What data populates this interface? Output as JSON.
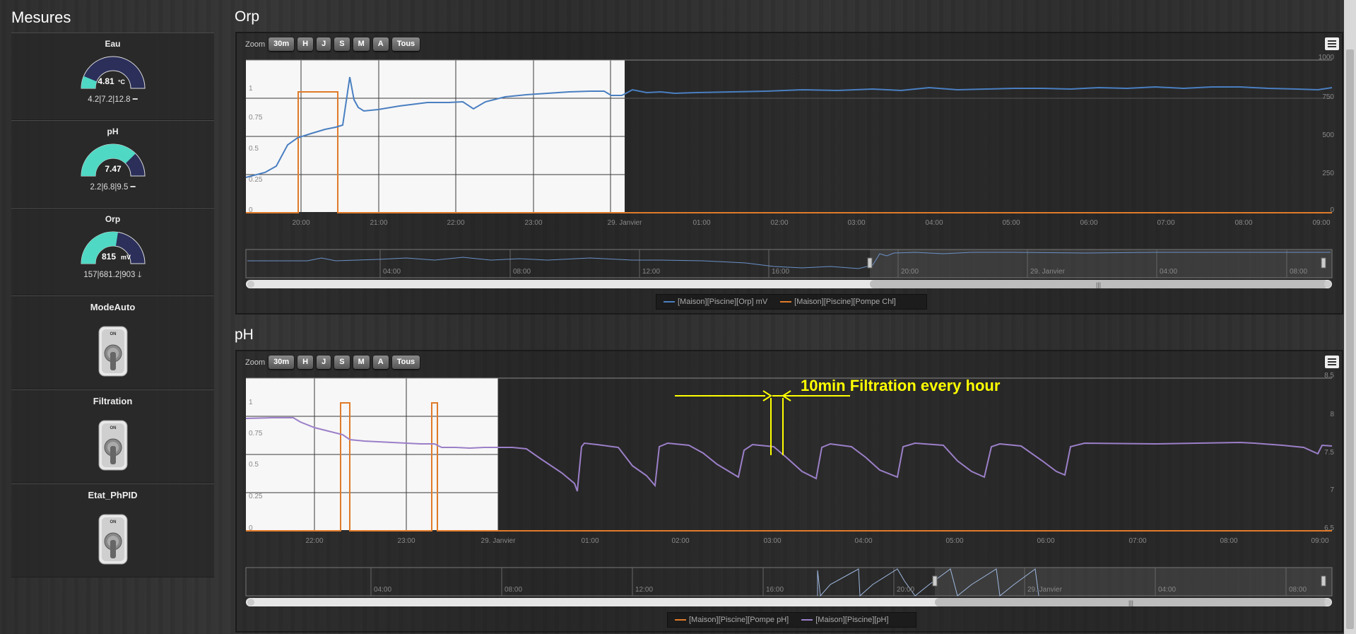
{
  "sidebar": {
    "title": "Mesures",
    "gauges": [
      {
        "name": "Eau",
        "value": "4.81",
        "unit": "°C",
        "minmax": "4.2|7.2|12.8",
        "trend": "━",
        "fill": 0.15
      },
      {
        "name": "pH",
        "value": "7.47",
        "unit": "",
        "minmax": "2.2|6.8|9.5",
        "trend": "━",
        "fill": 0.75
      },
      {
        "name": "Orp",
        "value": "815",
        "unit": "mV",
        "minmax": "157|681.2|903",
        "trend": "🡓",
        "fill": 0.55
      }
    ],
    "toggles": [
      {
        "name": "ModeAuto",
        "on_label": "ON"
      },
      {
        "name": "Filtration",
        "on_label": "ON"
      },
      {
        "name": "Etat_PhPID",
        "on_label": "ON"
      }
    ]
  },
  "orp": {
    "title": "Orp",
    "zoom_label": "Zoom",
    "zoom_buttons": [
      "30m",
      "H",
      "J",
      "S",
      "M",
      "A",
      "Tous"
    ],
    "left_ticks": [
      "1",
      "0.75",
      "0.5",
      "0.25",
      "0"
    ],
    "right_ticks": [
      "1000",
      "750",
      "500",
      "250",
      "0"
    ],
    "x_ticks": [
      "20:00",
      "21:00",
      "22:00",
      "23:00",
      "29. Janvier",
      "01:00",
      "02:00",
      "03:00",
      "04:00",
      "05:00",
      "06:00",
      "07:00",
      "08:00",
      "09:00"
    ],
    "nav_ticks": [
      "04:00",
      "08:00",
      "12:00",
      "16:00",
      "20:00",
      "29. Janvier",
      "04:00",
      "08:00"
    ],
    "legend": [
      "[Maison][Piscine][Orp] mV",
      "[Maison][Piscine][Pompe Chl]"
    ]
  },
  "ph": {
    "title": "pH",
    "zoom_label": "Zoom",
    "zoom_buttons": [
      "30m",
      "H",
      "J",
      "S",
      "M",
      "A",
      "Tous"
    ],
    "left_ticks": [
      "1",
      "0.75",
      "0.5",
      "0.25",
      "0"
    ],
    "right_ticks": [
      "8.5",
      "8",
      "7.5",
      "7",
      "6.5"
    ],
    "x_ticks": [
      "22:00",
      "23:00",
      "29. Janvier",
      "01:00",
      "02:00",
      "03:00",
      "04:00",
      "05:00",
      "06:00",
      "07:00",
      "08:00",
      "09:00"
    ],
    "nav_ticks": [
      "04:00",
      "08:00",
      "12:00",
      "16:00",
      "20:00",
      "29. Janvier",
      "04:00",
      "08:00"
    ],
    "annotation": "10min Filtration every hour",
    "legend": [
      "[Maison][Piscine][Pompe pH]",
      "[Maison][Piscine][pH]"
    ]
  },
  "colors": {
    "orp_line": "#4a7fc1",
    "pump_line": "#e07b2a",
    "ph_line": "#9b7fc8",
    "gauge_fill": "#4fd8c4",
    "gauge_back": "#2b2f5a",
    "annotation": "#ffff00"
  }
}
